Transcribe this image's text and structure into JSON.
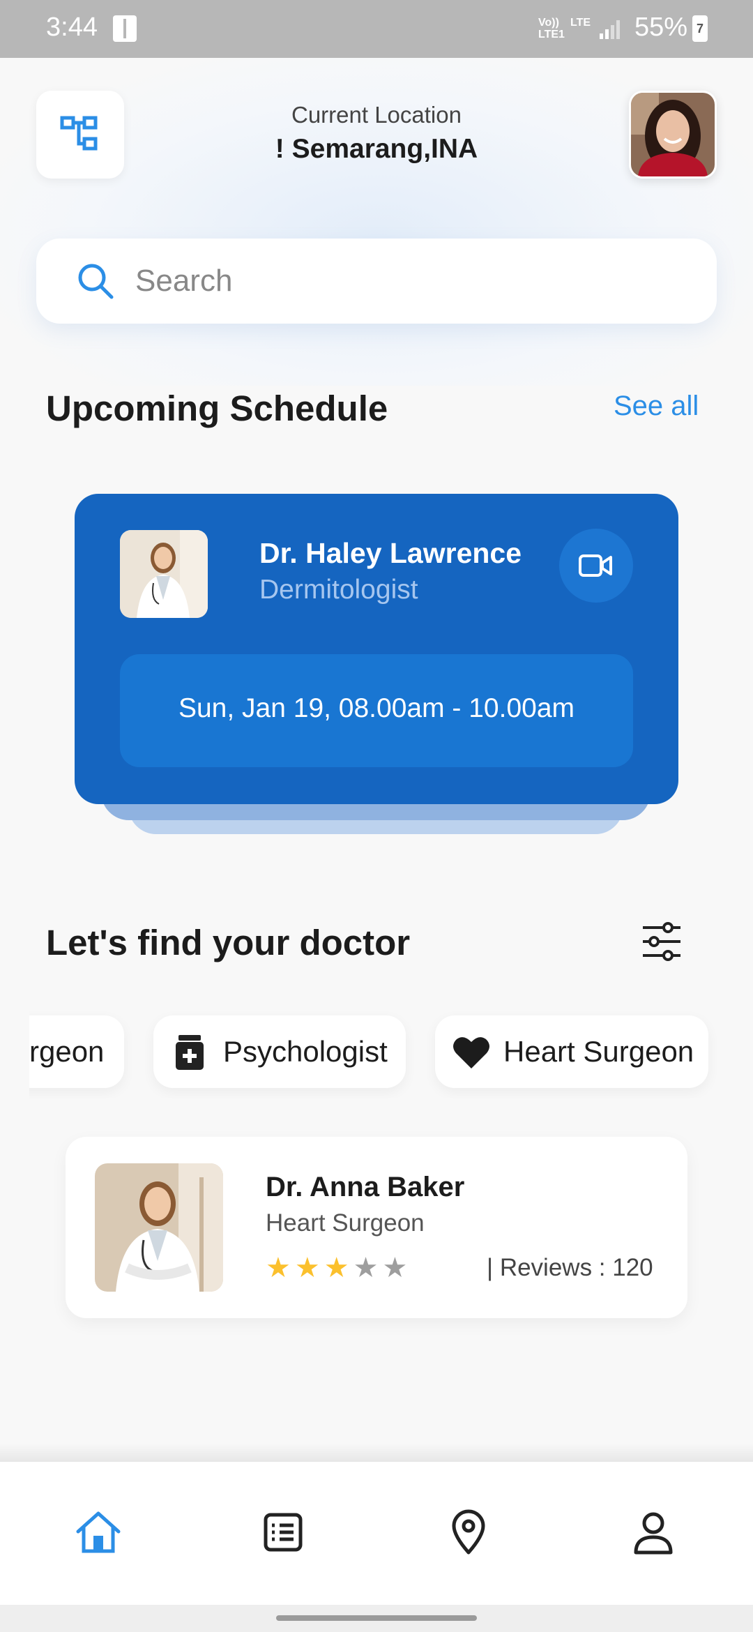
{
  "status_bar": {
    "time": "3:44",
    "network_top": "Vo)) LTE1",
    "network_side": "LTE",
    "battery_percent": "55%",
    "battery_badge": "7"
  },
  "header": {
    "location_label": "Current Location",
    "location_value": "! Semarang,INA"
  },
  "search": {
    "placeholder": "Search"
  },
  "upcoming": {
    "title": "Upcoming Schedule",
    "see_all": "See all",
    "card": {
      "doctor_name": "Dr. Haley Lawrence",
      "specialty": "Dermitologist",
      "datetime": "Sun, Jan 19, 08.00am - 10.00am"
    }
  },
  "find": {
    "title": "Let's find your doctor",
    "categories": [
      {
        "label": "rgeon",
        "icon": "scalpel-icon"
      },
      {
        "label": "Psychologist",
        "icon": "medicine-icon"
      },
      {
        "label": "Heart Surgeon",
        "icon": "heart-icon"
      }
    ]
  },
  "doctor_list": [
    {
      "name": "Dr. Anna Baker",
      "specialty": "Heart Surgeon",
      "rating": 3,
      "rating_max": 5,
      "reviews": "| Reviews : 120"
    }
  ],
  "nav": {
    "items": [
      "home-icon",
      "list-icon",
      "location-pin-icon",
      "profile-icon"
    ],
    "active": "home-icon"
  },
  "colors": {
    "primary": "#1565c0",
    "accent": "#2b8ee6",
    "star": "#fbc02d",
    "star_empty": "#9e9e9e"
  }
}
